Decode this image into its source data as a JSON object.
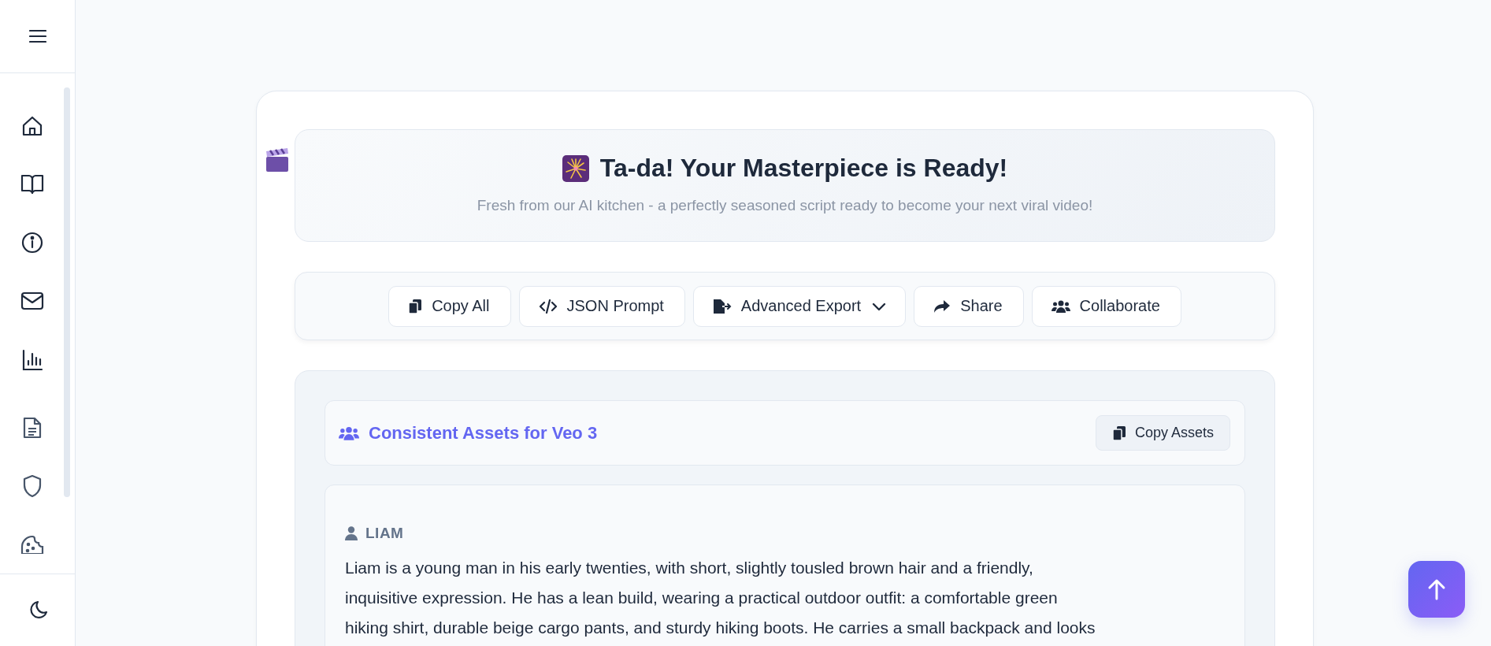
{
  "header": {
    "title": "Ta-da! Your Masterpiece is Ready!",
    "subtitle": "Fresh from our AI kitchen - a perfectly seasoned script ready to become your next viral video!"
  },
  "toolbar": {
    "buttons": [
      {
        "label": "Copy All",
        "dropdown": false
      },
      {
        "label": "JSON Prompt",
        "dropdown": false
      },
      {
        "label": "Advanced Export",
        "dropdown": true
      },
      {
        "label": "Share",
        "dropdown": false
      },
      {
        "label": "Collaborate",
        "dropdown": false
      }
    ]
  },
  "assets": {
    "title": "Consistent Assets for Veo 3",
    "copy_button": "Copy Assets",
    "characters": [
      {
        "name": "LIAM",
        "description_lines": [
          "Liam is a young man in his early twenties, with short, slightly tousled brown hair and a friendly,",
          "inquisitive expression. He has a lean build, wearing a practical outdoor outfit: a comfortable green",
          "hiking shirt, durable beige cargo pants, and sturdy hiking boots. He carries a small backpack and looks"
        ]
      }
    ]
  }
}
